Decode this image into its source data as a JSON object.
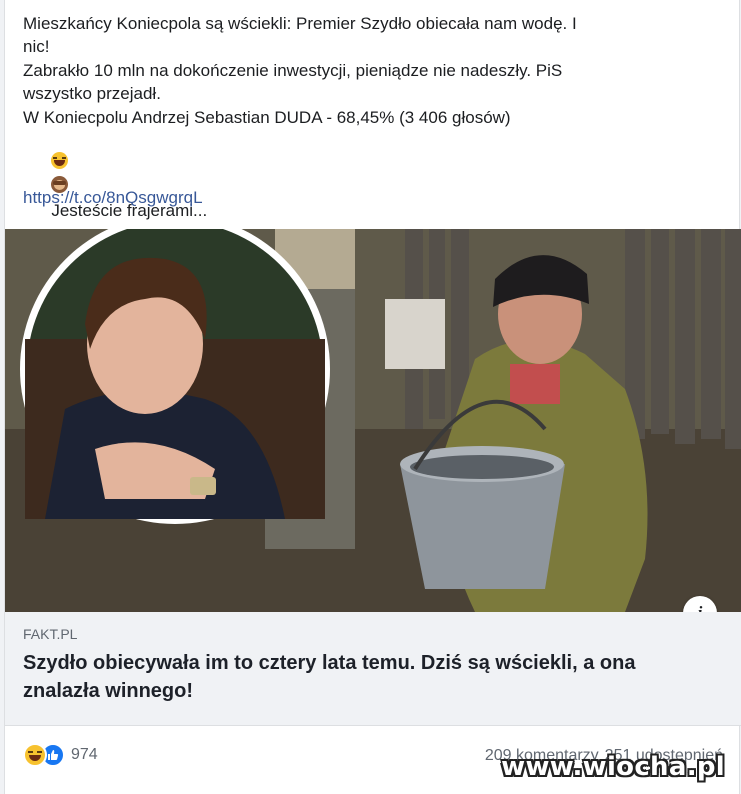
{
  "post": {
    "text_lines": [
      "Mieszkańcy Koniecpola są wściekli: Premier Szydło obiecała nam wodę. I",
      "nic!",
      "Zabrakło 10 mln na dokończenie inwestycji, pieniądze nie nadeszły. PiS",
      "wszystko przejadł.",
      "W Koniecpolu Andrzej Sebastian DUDA - 68,45% (3 406 głosów)"
    ],
    "emoji_line_text": "Jesteście frajerami...",
    "emoji_icons": [
      "rolling-laughing-emoji",
      "see-no-evil-monkey-emoji"
    ],
    "link": "https://t.co/8nQsgwgrqL"
  },
  "link_preview": {
    "source": "FAKT.PL",
    "title": "Szydło obiecywała im to cztery lata temu. Dziś są wściekli, a ona znalazła winnego!",
    "info_icon": "i"
  },
  "engagement": {
    "reaction_icons": [
      "haha-reaction-icon",
      "like-reaction-icon"
    ],
    "reaction_count": "974",
    "comments": "209 komentarzy",
    "shares": "251 udostępnień"
  },
  "watermark": "www.wiocha.pl",
  "colors": {
    "link": "#385898",
    "preview_bg": "#f0f2f5",
    "like_blue": "#1877f2",
    "haha_yellow": "#f7c22f"
  }
}
